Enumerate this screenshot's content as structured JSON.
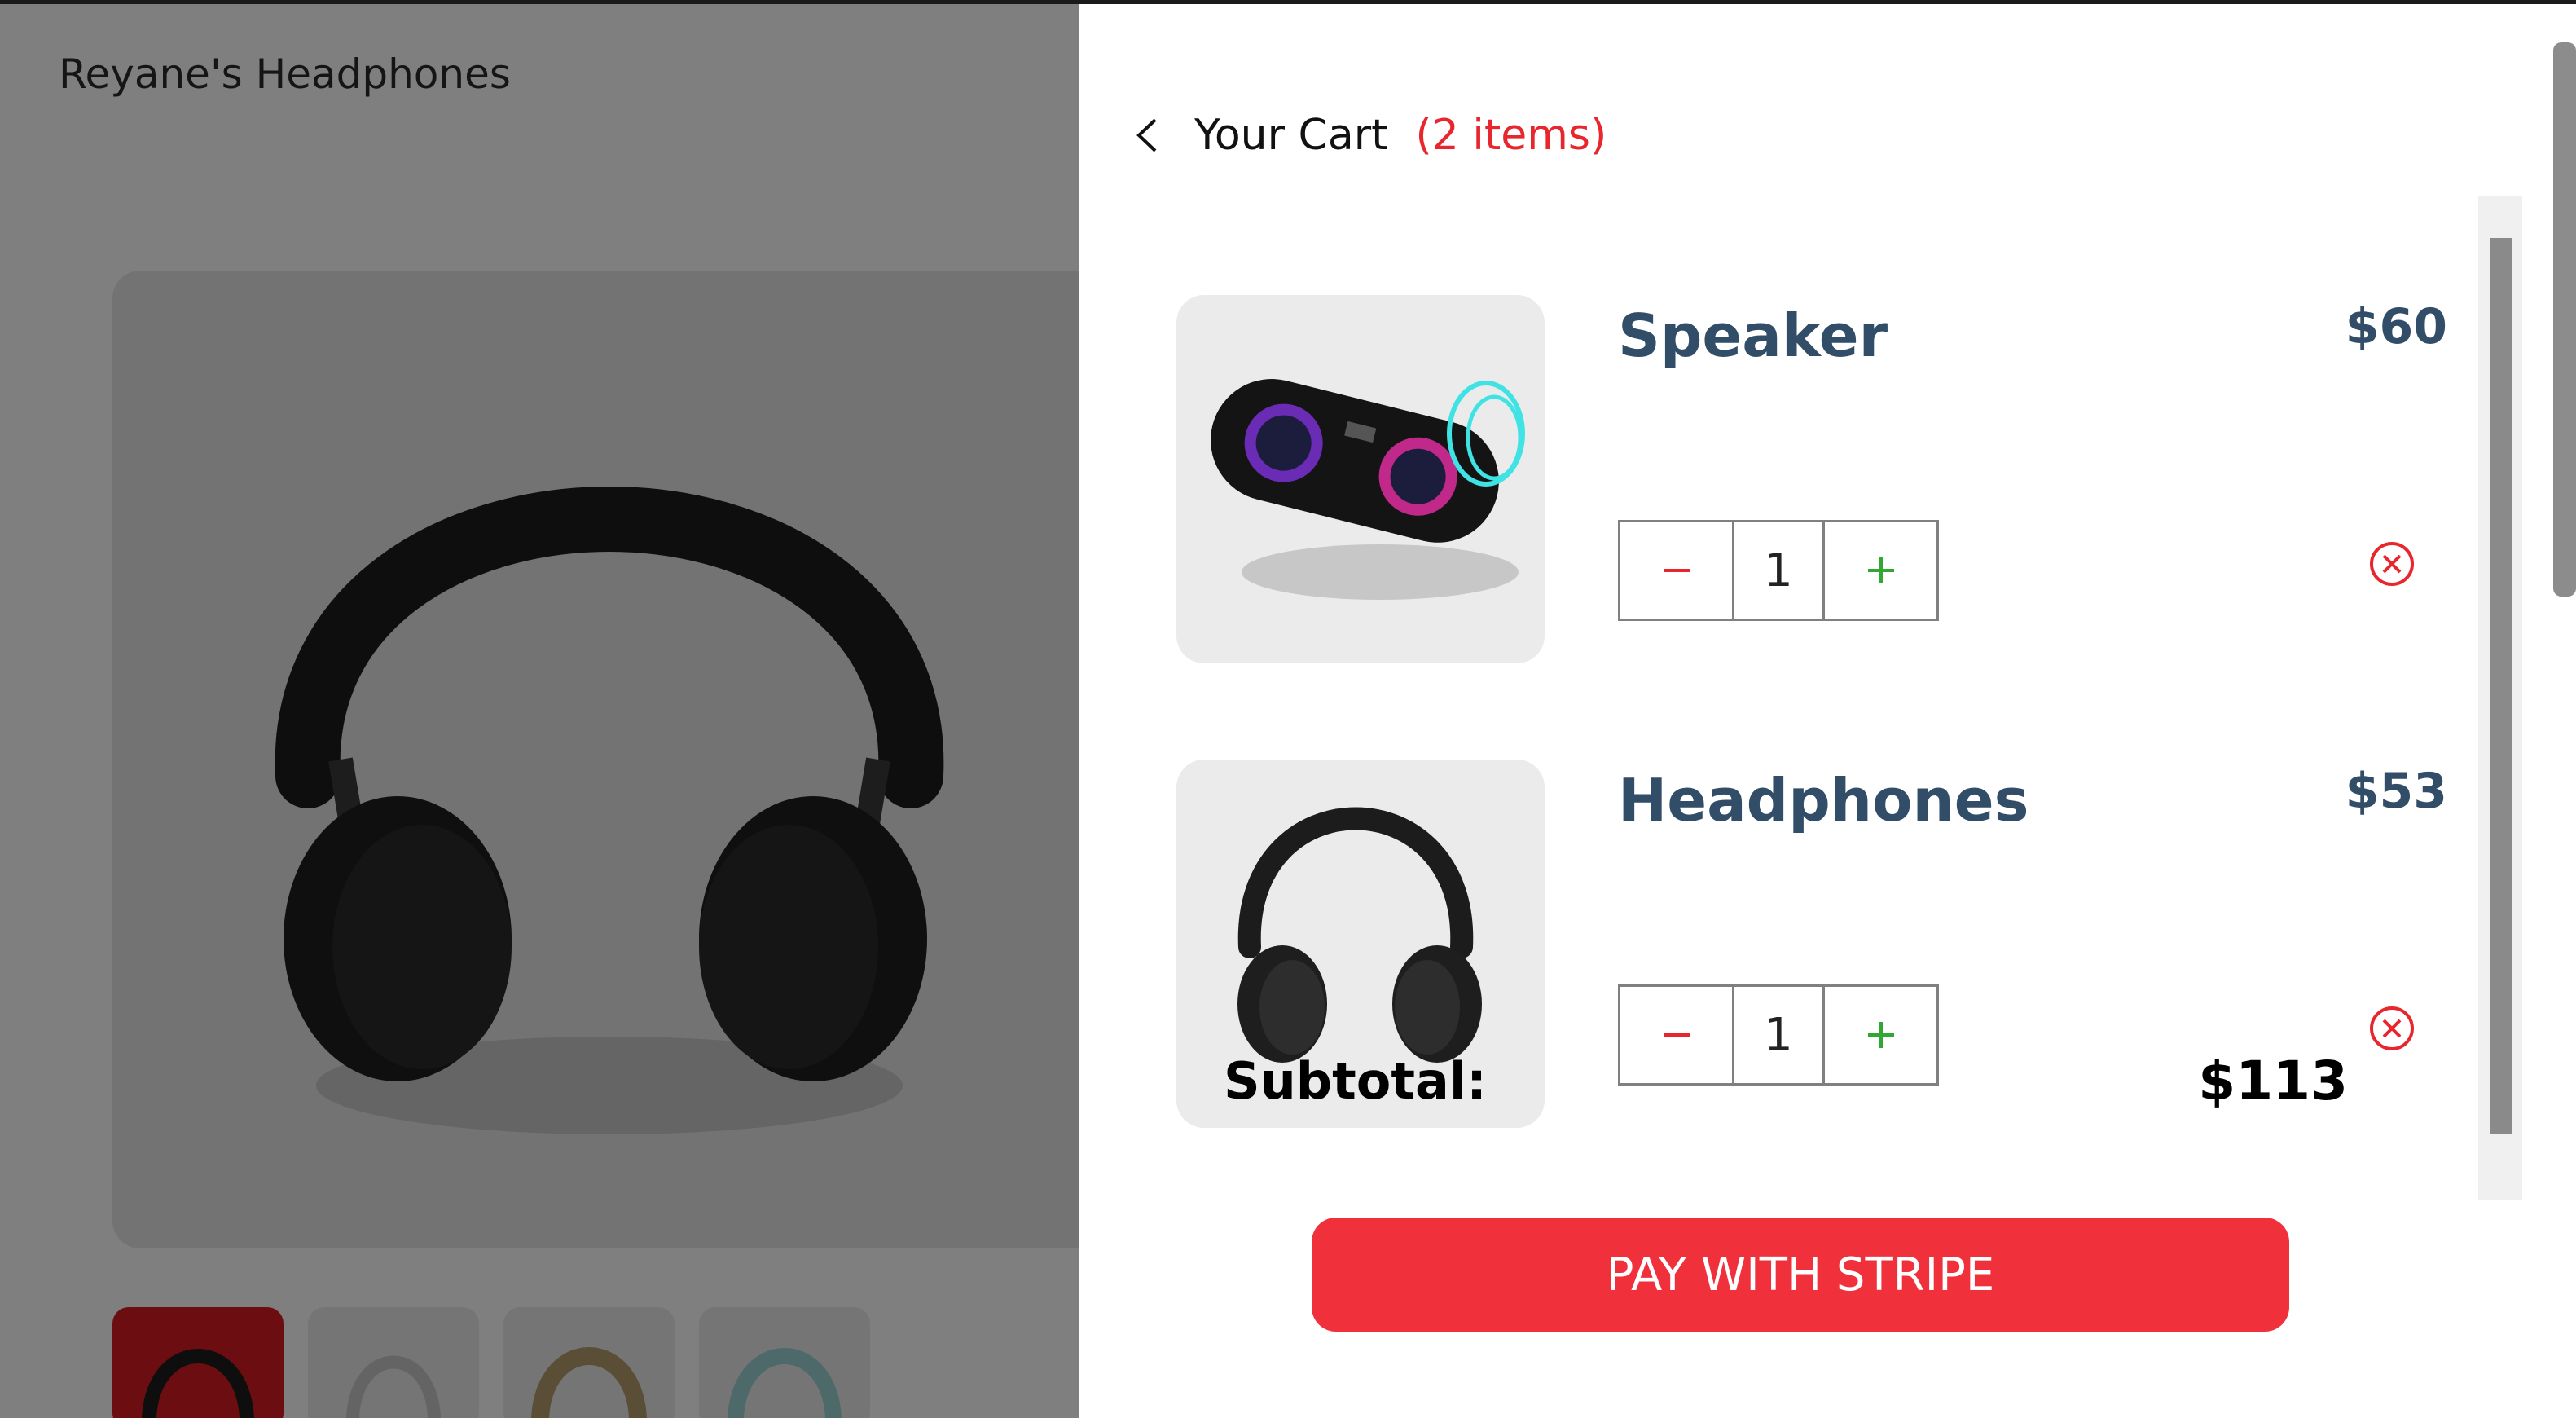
{
  "store": {
    "brand": "Reyane's Headphones",
    "thumbnails": [
      "black-headphones",
      "white-headphones",
      "beige-headphones",
      "mint-headphones"
    ]
  },
  "cart": {
    "title": "Your Cart",
    "count_label": "(2 items)",
    "items": [
      {
        "name": "Speaker",
        "price": "$60",
        "quantity": "1",
        "image": "speaker"
      },
      {
        "name": "Headphones",
        "price": "$53",
        "quantity": "1",
        "image": "headphones"
      }
    ],
    "subtotal_label": "Subtotal:",
    "subtotal_value": "$113",
    "pay_label": "PAY WITH STRIPE"
  },
  "icons": {
    "back": "chevron-left-icon",
    "minus": "minus-icon",
    "plus": "plus-icon",
    "remove": "close-circle-icon"
  },
  "colors": {
    "accent_red": "#f0313b",
    "count_red": "#e8262d",
    "name_blue": "#324d67",
    "plus_green": "#31a831",
    "thumb_active": "#d91d22"
  }
}
